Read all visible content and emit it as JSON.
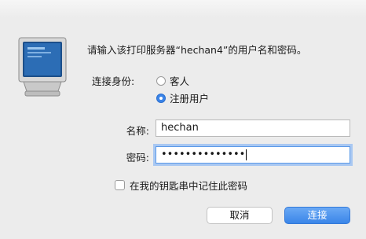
{
  "dialog": {
    "message": "请输入该打印服务器“hechan4”的用户名和密码。",
    "connect_as_label": "连接身份:",
    "options": [
      {
        "label": "客人",
        "selected": false
      },
      {
        "label": "注册用户",
        "selected": true
      }
    ],
    "name_label": "名称:",
    "name_value": "hechan",
    "password_label": "密码:",
    "password_value": "••••••••••••••",
    "remember_label": "在我的钥匙串中记住此密码",
    "remember_checked": false,
    "cancel_label": "取消",
    "connect_label": "连接"
  },
  "icon": "printer-server-monitor-icon",
  "colors": {
    "accent": "#3b84e8",
    "background": "#ececec"
  }
}
